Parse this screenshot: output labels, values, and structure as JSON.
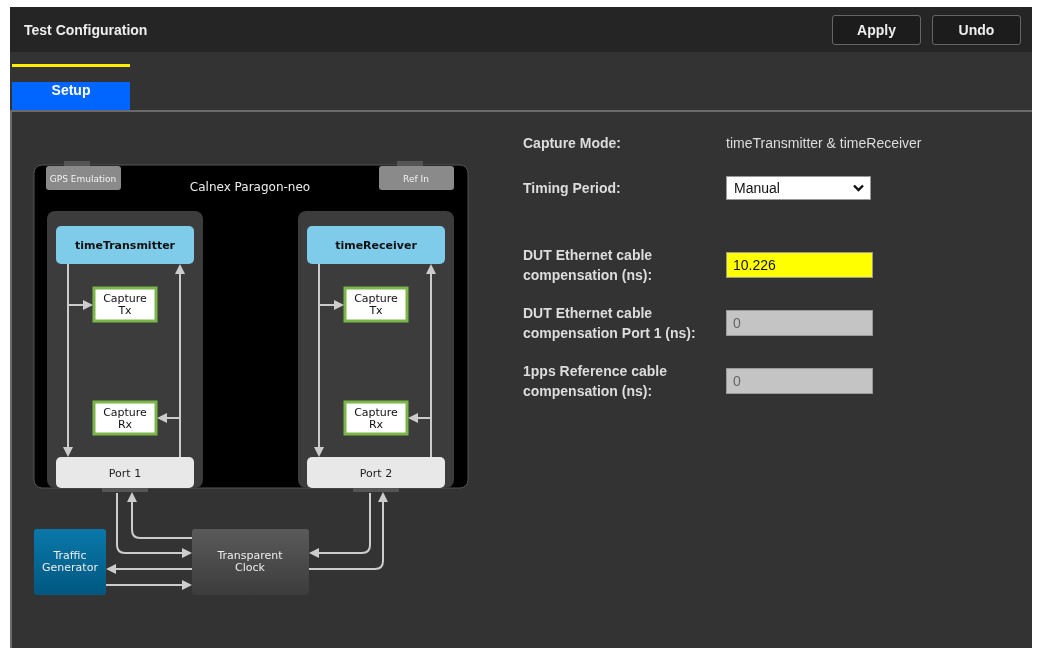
{
  "window": {
    "title": "Test Configuration"
  },
  "header_buttons": [
    "Apply",
    "Undo"
  ],
  "tabs": [
    {
      "label": "Setup",
      "selected": true
    }
  ],
  "diagram": {
    "device": "Calnex Paragon-neo",
    "inputs": [
      {
        "label": "GPS Emulation",
        "disabled": true
      },
      {
        "label": "Ref In",
        "disabled": true
      }
    ],
    "ports": [
      {
        "role": "timeTransmitter",
        "capture_tx": [
          "Capture",
          "Tx"
        ],
        "capture_rx": [
          "Capture",
          "Rx"
        ],
        "port": "Port 1"
      },
      {
        "role": "timeReceiver",
        "capture_tx": [
          "Capture",
          "Tx"
        ],
        "capture_rx": [
          "Capture",
          "Rx"
        ],
        "port": "Port 2"
      }
    ],
    "traffic_generator": [
      "Traffic",
      "Generator"
    ],
    "transparent_clock": [
      "Transparent",
      "Clock"
    ]
  },
  "fields": [
    {
      "kind": "text",
      "label": "Capture Mode:",
      "value": "timeTransmitter & timeReceiver"
    },
    {
      "kind": "select",
      "label": "Timing Period:",
      "value": "Manual"
    },
    {
      "kind": "input",
      "label": "DUT Ethernet cable compensation (ns):",
      "value": "10.226",
      "highlighted": true,
      "disabled": false
    },
    {
      "kind": "input",
      "label": "DUT Ethernet cable compensation Port 1 (ns):",
      "value": "0",
      "highlighted": false,
      "disabled": true
    },
    {
      "kind": "input",
      "label": "1pps Reference cable compensation (ns):",
      "value": "0",
      "highlighted": false,
      "disabled": true
    }
  ]
}
